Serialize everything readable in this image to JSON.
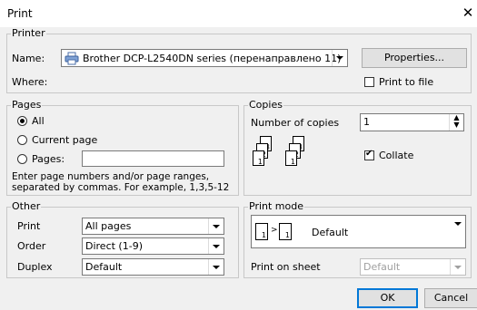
{
  "window": {
    "title": "Print",
    "close_glyph": "✕"
  },
  "printer": {
    "legend": "Printer",
    "name_label": "Name:",
    "name_value": "Brother DCP-L2540DN series (перенаправлено 11)",
    "printer_icon": "printer-icon",
    "properties_label": "Properties...",
    "where_label": "Where:",
    "print_to_file_label": "Print to file",
    "print_to_file_checked": false
  },
  "pages": {
    "legend": "Pages",
    "all_label": "All",
    "current_label": "Current page",
    "pages_label": "Pages:",
    "pages_value": "",
    "selected": "all",
    "hint_line1": "Enter page numbers and/or page ranges,",
    "hint_line2": "separated by commas. For example, 1,3,5-12"
  },
  "copies": {
    "legend": "Copies",
    "number_label": "Number of copies",
    "number_value": "1",
    "collate_label": "Collate",
    "collate_checked": true,
    "page_numbers": [
      "1",
      "2",
      "3",
      "1",
      "2",
      "3"
    ]
  },
  "other": {
    "legend": "Other",
    "print_label": "Print",
    "print_value": "All pages",
    "order_label": "Order",
    "order_value": "Direct (1-9)",
    "duplex_label": "Duplex",
    "duplex_value": "Default"
  },
  "print_mode": {
    "legend": "Print mode",
    "mode_value": "Default",
    "mode_pages": [
      "1",
      "1"
    ],
    "print_on_sheet_label": "Print on sheet",
    "print_on_sheet_value": "Default"
  },
  "buttons": {
    "ok": "OK",
    "cancel": "Cancel"
  }
}
